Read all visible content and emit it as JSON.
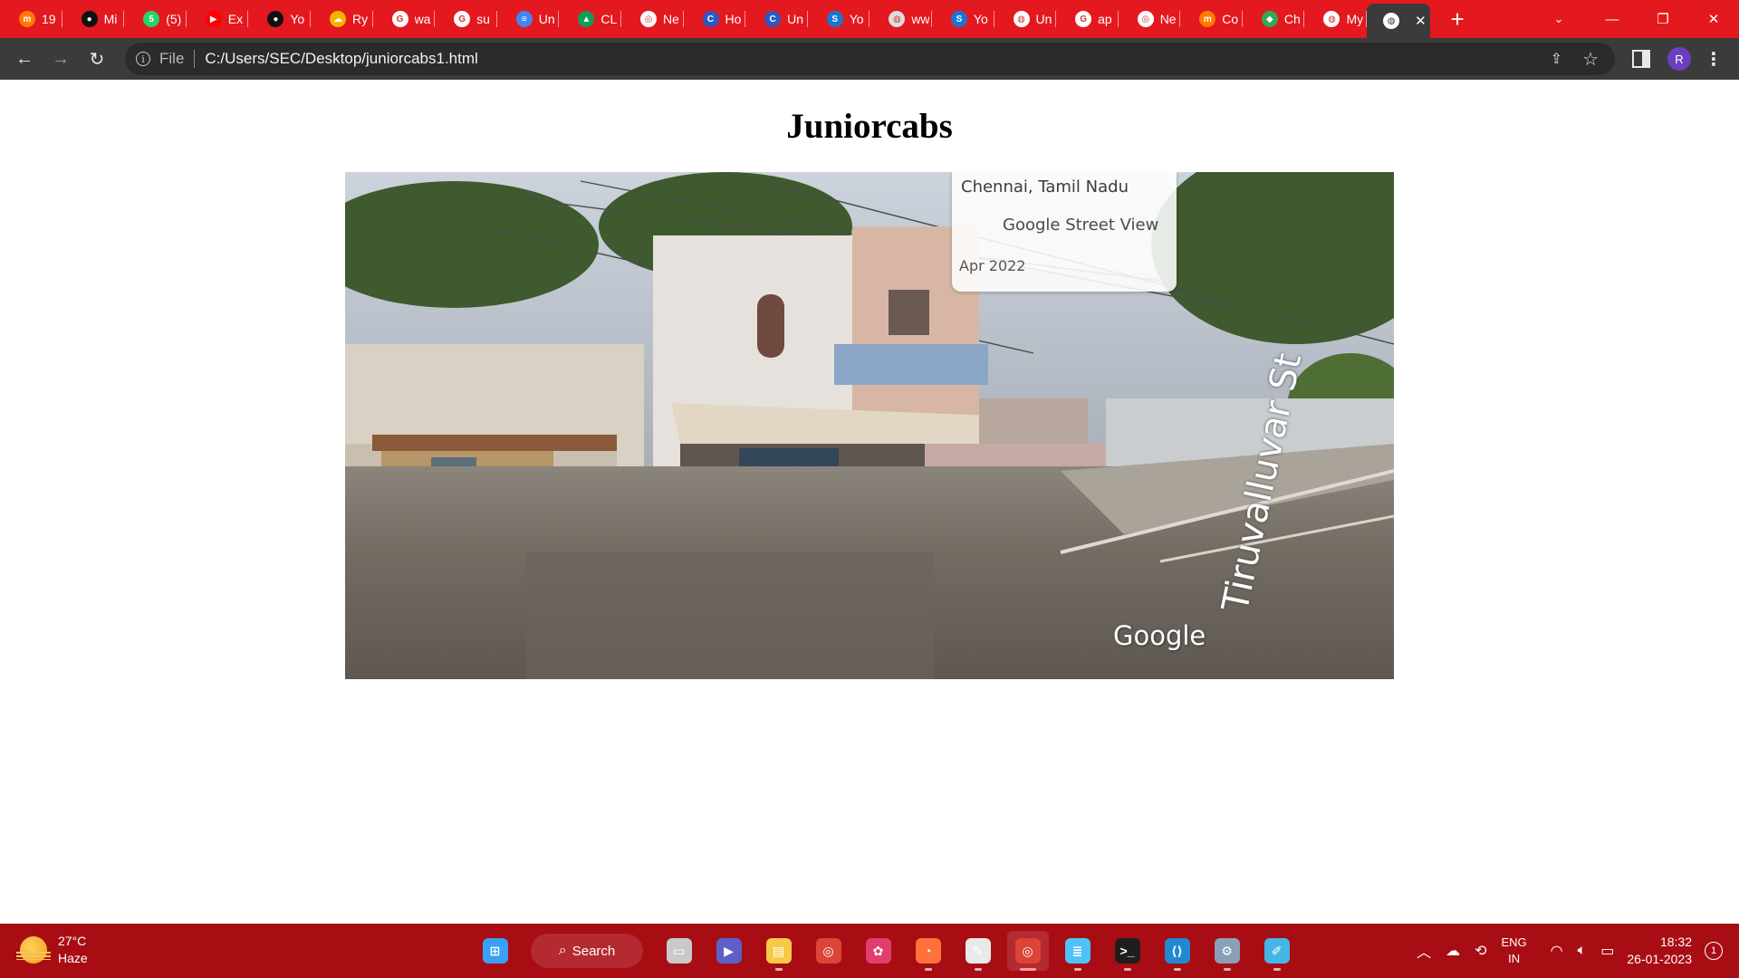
{
  "browser": {
    "tabs": [
      {
        "icon": "m-icon",
        "label": "19",
        "fav_color": "#ff7a00",
        "fav_glyph": "m"
      },
      {
        "icon": "github-icon",
        "label": "Mi",
        "fav_color": "#111111",
        "fav_glyph": "●"
      },
      {
        "icon": "whatsapp-icon",
        "label": "(5)",
        "fav_color": "#25d366",
        "fav_glyph": "5"
      },
      {
        "icon": "youtube-icon",
        "label": "Ex",
        "fav_color": "#ff0000",
        "fav_glyph": "▶"
      },
      {
        "icon": "github-icon",
        "label": "Yo",
        "fav_color": "#111111",
        "fav_glyph": "●"
      },
      {
        "icon": "cloud-icon",
        "label": "Ry",
        "fav_color": "#f5b400",
        "fav_glyph": "☁"
      },
      {
        "icon": "google-icon",
        "label": "wa",
        "fav_color": "#ffffff",
        "fav_glyph": "G"
      },
      {
        "icon": "google-icon",
        "label": "su",
        "fav_color": "#ffffff",
        "fav_glyph": "G"
      },
      {
        "icon": "docs-icon",
        "label": "Un",
        "fav_color": "#4285f4",
        "fav_glyph": "≡"
      },
      {
        "icon": "drive-icon",
        "label": "CL",
        "fav_color": "#0f9d58",
        "fav_glyph": "▲"
      },
      {
        "icon": "chrome-icon",
        "label": "Ne",
        "fav_color": "#ffffff",
        "fav_glyph": "◎"
      },
      {
        "icon": "copilot-icon",
        "label": "Ho",
        "fav_color": "#2b59c3",
        "fav_glyph": "C"
      },
      {
        "icon": "copilot-icon",
        "label": "Un",
        "fav_color": "#2b59c3",
        "fav_glyph": "C"
      },
      {
        "icon": "s-icon",
        "label": "Yo",
        "fav_color": "#1976d2",
        "fav_glyph": "S"
      },
      {
        "icon": "globe-icon",
        "label": "ww",
        "fav_color": "#dddddd",
        "fav_glyph": "◍"
      },
      {
        "icon": "s-icon",
        "label": "Yo",
        "fav_color": "#1976d2",
        "fav_glyph": "S"
      },
      {
        "icon": "globe-icon",
        "label": "Un",
        "fav_color": "#ffffff",
        "fav_glyph": "◍"
      },
      {
        "icon": "google-icon",
        "label": "ap",
        "fav_color": "#ffffff",
        "fav_glyph": "G"
      },
      {
        "icon": "chrome-icon",
        "label": "Ne",
        "fav_color": "#ffffff",
        "fav_glyph": "◎"
      },
      {
        "icon": "m-icon",
        "label": "Co",
        "fav_color": "#ff7a00",
        "fav_glyph": "m"
      },
      {
        "icon": "maps-icon",
        "label": "Ch",
        "fav_color": "#34a853",
        "fav_glyph": "◆"
      },
      {
        "icon": "globe-icon",
        "label": "My",
        "fav_color": "#ffffff",
        "fav_glyph": "◍"
      }
    ],
    "address": {
      "scheme": "File",
      "url": "C:/Users/SEC/Desktop/juniorcabs1.html"
    },
    "profile_initial": "R",
    "accent": "#e4181f"
  },
  "page": {
    "heading": "Juniorcabs",
    "streetview": {
      "location": "Chennai, Tamil Nadu",
      "source": "Google Street View",
      "date": "Apr 2022",
      "logo": "Google",
      "street_name": "Tiruvalluvar St"
    }
  },
  "taskbar": {
    "weather_temp": "27°C",
    "weather_desc": "Haze",
    "search_label": "Search",
    "apps": [
      {
        "name": "start-icon",
        "color": "#3aa0f3",
        "glyph": "⊞",
        "running": false
      },
      {
        "name": "task-view-icon",
        "color": "#c9c9c9",
        "glyph": "▭",
        "running": false
      },
      {
        "name": "teams-icon",
        "color": "#5b5fc7",
        "glyph": "▶",
        "running": false
      },
      {
        "name": "file-explorer-icon",
        "color": "#f7c948",
        "glyph": "▤",
        "running": true
      },
      {
        "name": "chrome-icon",
        "color": "#db4437",
        "glyph": "◎",
        "running": false
      },
      {
        "name": "photos-icon",
        "color": "#e23d6d",
        "glyph": "✿",
        "running": false
      },
      {
        "name": "firefox-icon",
        "color": "#ff7139",
        "glyph": "◔",
        "running": true
      },
      {
        "name": "document-icon",
        "color": "#e9e9e9",
        "glyph": "✎",
        "running": true
      },
      {
        "name": "chrome-profile-icon",
        "color": "#db4437",
        "glyph": "◎",
        "running": true,
        "active": true
      },
      {
        "name": "notepad-icon",
        "color": "#4fc3f7",
        "glyph": "≣",
        "running": true
      },
      {
        "name": "terminal-icon",
        "color": "#1e1e1e",
        "glyph": ">_",
        "running": true
      },
      {
        "name": "vscode-icon",
        "color": "#1f8ad2",
        "glyph": "⟨⟩",
        "running": true
      },
      {
        "name": "settings-icon",
        "color": "#8aa0b8",
        "glyph": "⚙",
        "running": true
      },
      {
        "name": "paint-icon",
        "color": "#45b5e8",
        "glyph": "✐",
        "running": true
      }
    ],
    "lang_primary": "ENG",
    "lang_secondary": "IN",
    "time": "18:32",
    "date": "26-01-2023",
    "notifications": "1"
  }
}
